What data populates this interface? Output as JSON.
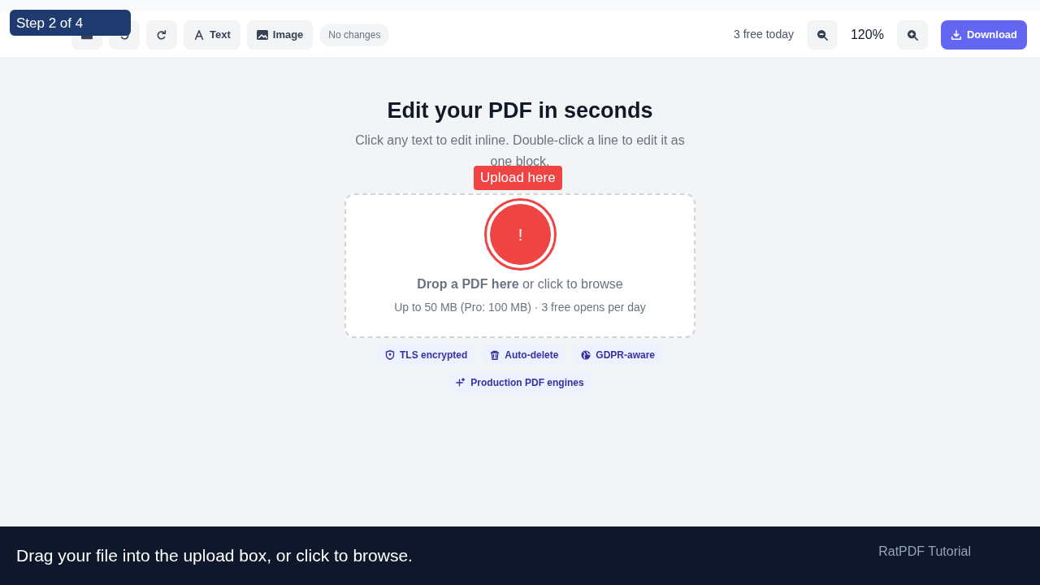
{
  "toolbar": {
    "text_label": "Text",
    "image_label": "Image",
    "status": "No changes",
    "quota": "3 free today",
    "zoom": "120%",
    "download_label": "Download"
  },
  "hero": {
    "title": "Edit your PDF in seconds",
    "subtitle": "Click any text to edit inline. Double-click a line to edit it as one block."
  },
  "dropzone": {
    "headline": "**Drop a PDF here** or click to browse",
    "limits": "Up to 50 MB (Pro: 100 MB) · 3 free opens per day"
  },
  "features": [
    {
      "kind": "shield",
      "label": "TLS encrypted"
    },
    {
      "kind": "trash",
      "label": "Auto-delete"
    },
    {
      "kind": "globe",
      "label": "GDPR-aware"
    },
    {
      "kind": "sparkle",
      "label": "Production PDF engines"
    }
  ],
  "tutorial": {
    "step": "Step 2 of 4",
    "tooltip": "Upload here",
    "marker": "!",
    "caption": "Drag your file into the upload box, or click to browse.",
    "credit": "RatPDF Tutorial"
  }
}
